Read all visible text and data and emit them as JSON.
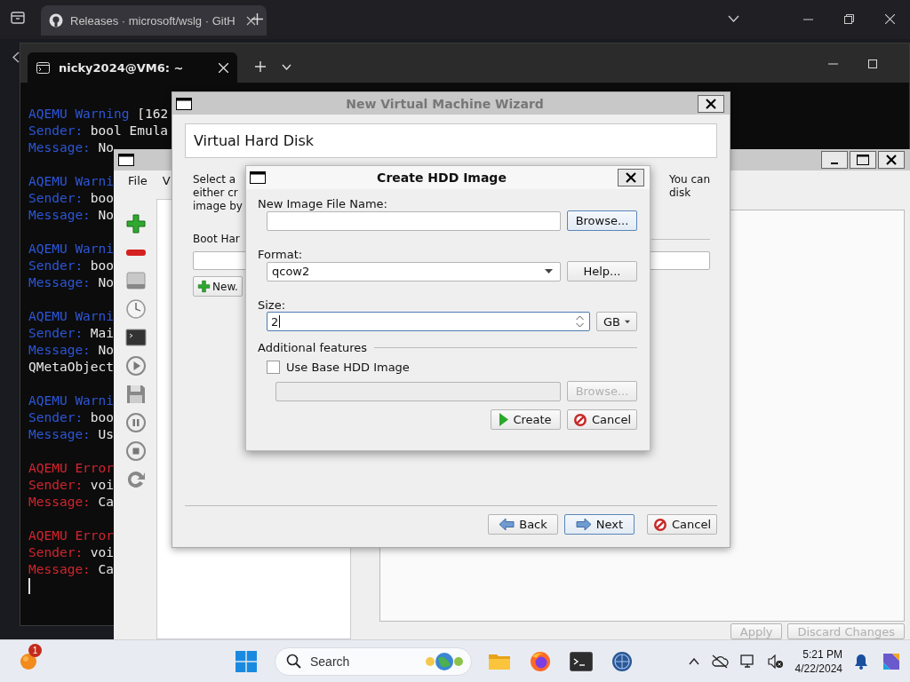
{
  "browser": {
    "tab_title": "Releases · microsoft/wslg · GitH"
  },
  "terminal": {
    "tab_title": "nicky2024@VM6: ~",
    "entries": [
      {
        "kind": "warning",
        "lines": [
          {
            "label": "AQEMU Warning",
            "text": "[162"
          },
          {
            "label": "Sender:",
            "text": "bool Emula"
          },
          {
            "label": "Message:",
            "text": "No"
          }
        ]
      },
      {
        "kind": "warning",
        "lines": [
          {
            "label": "AQEMU Warni"
          },
          {
            "label": "Sender:",
            "text": "boo"
          },
          {
            "label": "Message:",
            "text": "No"
          }
        ]
      },
      {
        "kind": "warning",
        "lines": [
          {
            "label": "AQEMU Warni"
          },
          {
            "label": "Sender:",
            "text": "boo"
          },
          {
            "label": "Message:",
            "text": "No"
          }
        ]
      },
      {
        "kind": "warning",
        "lines": [
          {
            "label": "AQEMU Warni"
          },
          {
            "label": "Sender:",
            "text": "Mai"
          },
          {
            "label": "Message:",
            "text": "No"
          },
          {
            "text": "QMetaObject"
          }
        ]
      },
      {
        "kind": "warning",
        "lines": [
          {
            "label": "AQEMU Warni"
          },
          {
            "label": "Sender:",
            "text": "boo"
          },
          {
            "label": "Message:",
            "text": "Us"
          }
        ]
      },
      {
        "kind": "error",
        "lines": [
          {
            "label": "AQEMU Error"
          },
          {
            "label": "Sender:",
            "text": "voi"
          },
          {
            "label": "Message:",
            "text": "Ca"
          }
        ]
      },
      {
        "kind": "error",
        "lines": [
          {
            "label": "AQEMU Error"
          },
          {
            "label": "Sender:",
            "text": "voi"
          },
          {
            "label": "Message:",
            "text": "Ca"
          }
        ]
      }
    ]
  },
  "aqemu": {
    "menu": [
      "File",
      "V"
    ],
    "buttons": [
      {
        "label": "Apply",
        "disabled": true
      },
      {
        "label": "Discard Changes",
        "disabled": true
      }
    ]
  },
  "wizard": {
    "title": "New Virtual Machine Wizard",
    "header": "Virtual Hard Disk",
    "intro_left": [
      "Select a",
      "either cr",
      "image by"
    ],
    "intro_right": [
      "You can",
      "disk"
    ],
    "boot_label": "Boot Har",
    "new_button": "New.",
    "buttons": [
      {
        "kind": "back",
        "label": "Back",
        "default": false
      },
      {
        "kind": "next",
        "label": "Next",
        "default": true
      },
      {
        "kind": "cancel",
        "label": "Cancel",
        "default": false
      }
    ]
  },
  "hdd_dialog": {
    "title": "Create HDD Image",
    "name_label": "New Image File Name:",
    "browse": {
      "label": "Browse...",
      "default": true
    },
    "format_label": "Format:",
    "format": "qcow2",
    "help": "Help...",
    "size_label": "Size:",
    "size_value": "2",
    "unit": "GB",
    "features_label": "Additional features",
    "base_image": {
      "label": "Use Base HDD Image",
      "checked": false
    },
    "base_browse": {
      "label": "Browse...",
      "disabled": true
    },
    "buttons": [
      {
        "kind": "create",
        "label": "Create"
      },
      {
        "kind": "cancel",
        "label": "Cancel"
      }
    ]
  },
  "taskbar": {
    "badge": "1",
    "search_placeholder": "Search",
    "time": "5:21 PM",
    "date": "4/22/2024"
  }
}
